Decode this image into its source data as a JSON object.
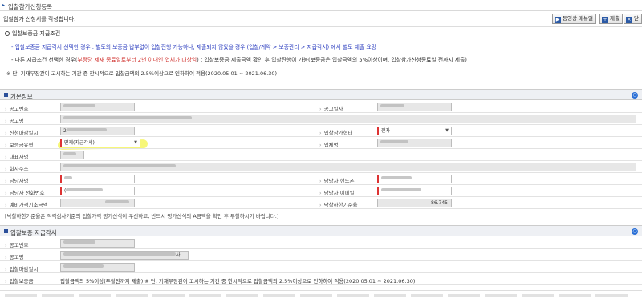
{
  "header": {
    "title": "입찰참가신청등록"
  },
  "notice": "입찰참가 신청서를 작성합니다.",
  "toolbar": {
    "manual_label": "동영상 매뉴얼",
    "submit_label": "제출",
    "close_label": "닫"
  },
  "guide": {
    "heading": "입찰보증금 지급조건",
    "line1": "- 입찰보증금 지급각서 선택한 경우 : 별도의 보증금 납부없이 입찰진행 가능하나, 제출되지 않았을 경우 (입찰/계약 > 보증관리 > 지급각서) 에서 별도 제출 요망",
    "line2_pre": "- 다른 지급조건 선택한 경우(",
    "line2_red": "부정당 제재 종료일로부터 2년 이내인 업체가 대상임",
    "line2_post": ") : 입찰보증금 제출금액 확인 후 입찰진행이 가능(보증금은 입찰금액의 5%이상이며, 입찰참가신청종료일 전까지 제출)",
    "line3": "※ 단, 기재부장관이 고시하는 기간 중 한시적으로 입찰금액의 2.5%이상으로 인하하여 적용(2020.05.01 ~ 2021.06.30)"
  },
  "basic": {
    "section_title": "기본정보",
    "toggle": "○",
    "labels": {
      "notice_no": "공고번호",
      "notice_date": "공고일자",
      "notice_name": "공고명",
      "apply_date": "신청마감일시",
      "eval_type": "입찰참가형태",
      "bond_type": "보증금유형",
      "company": "업체명",
      "rep": "대표자명",
      "address": "회사주소",
      "manager": "담당자명",
      "mobile": "담당자 핸드폰",
      "phone": "담당자 전화번호",
      "email": "담당자 이메일",
      "prelim_price": "예비가격기초금액",
      "rate": "낙찰하한기준율"
    },
    "values": {
      "apply_date_prefix": "2",
      "eval_type": "전자",
      "bond_type": "면제(지급각서)",
      "phone_prefix": "(",
      "rate": "86.745"
    }
  },
  "note": "[낙찰하한기준율은 적격심사기준의 입찰가격 평가산식이 우선하고, 반드시 평가산식의 A금액을 확인 후 투찰하시기 바랍니다.]",
  "bond": {
    "section_title": "입찰보증 지급각서",
    "toggle": "○",
    "labels": {
      "notice_no": "공고번호",
      "notice_name": "공고명",
      "apply_date": "입찰마감일시",
      "bond": "입찰보증금"
    },
    "values": {
      "notice_name_suffix": "사",
      "bond_text": "입찰금액의 5%이상(투찰전까지 제출) ※ 단, 기재부장관이 고시하는 기간 중 한시적으로 입찰금액의 2.5%이상으로 인하하여 적용(2020.05.01 ~ 2021.06.30)"
    }
  },
  "colors": {
    "accent": "#2b4f9a",
    "highlight": "#f1f00a",
    "required": "#dd3333"
  }
}
